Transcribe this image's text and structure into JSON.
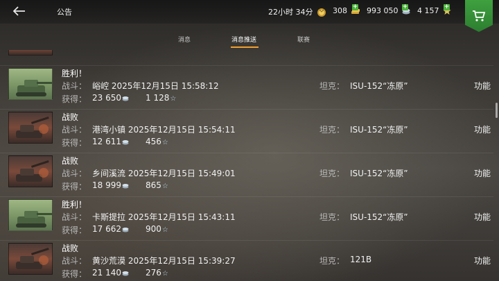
{
  "header": {
    "title": "公告",
    "timer": "22小时 34分",
    "gold": "308",
    "credits": "993 050",
    "xp": "4 157"
  },
  "tabs": [
    {
      "label": "消息",
      "active": false
    },
    {
      "label": "消息推送",
      "active": true
    },
    {
      "label": "联赛",
      "active": false
    }
  ],
  "labels": {
    "battle": "战斗：",
    "earned": "获得：",
    "tank": "坦克：",
    "function": "功能"
  },
  "rows": [
    {
      "result": "胜利！",
      "win": true,
      "battle": "峪崆 2025年12月15日 15:58:12",
      "credits": "23 650",
      "xp": "1 128",
      "tank": "ISU-152“冻原”"
    },
    {
      "result": "战败",
      "win": false,
      "battle": "港湾小镇 2025年12月15日 15:54:11",
      "credits": "12 611",
      "xp": "456",
      "tank": "ISU-152“冻原”"
    },
    {
      "result": "战败",
      "win": false,
      "battle": "乡间溪流 2025年12月15日 15:49:01",
      "credits": "18 999",
      "xp": "865",
      "tank": "ISU-152“冻原”"
    },
    {
      "result": "胜利！",
      "win": true,
      "battle": "卡斯提拉 2025年12月15日 15:43:11",
      "credits": "17 662",
      "xp": "900",
      "tank": "ISU-152“冻原”"
    },
    {
      "result": "战败",
      "win": false,
      "battle": "黄沙荒漠 2025年12月15日 15:39:27",
      "credits": "21 140",
      "xp": "276",
      "tank": "121B"
    }
  ]
}
